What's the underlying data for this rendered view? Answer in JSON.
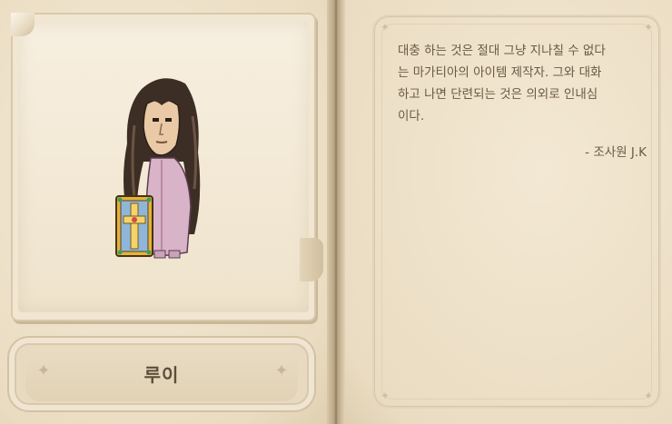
{
  "npc": {
    "name": "루이",
    "description": "대충 하는 것은 절대 그냥 지나칠 수 없다\n는 마가티아의 아이템 제작자. 그와 대화\n하고 나면 단련되는 것은 의외로 인내심\n이다.",
    "signature": "- 조사원 J.K",
    "portrait_icon": "npc-portrait-icon"
  },
  "decor": {
    "sparkle_left": "✦",
    "sparkle_right": "✦",
    "corner_glyph": "✦"
  },
  "colors": {
    "text": "#6a5a45",
    "name": "#5d4e3a",
    "parchment": "#f1e6d2"
  }
}
